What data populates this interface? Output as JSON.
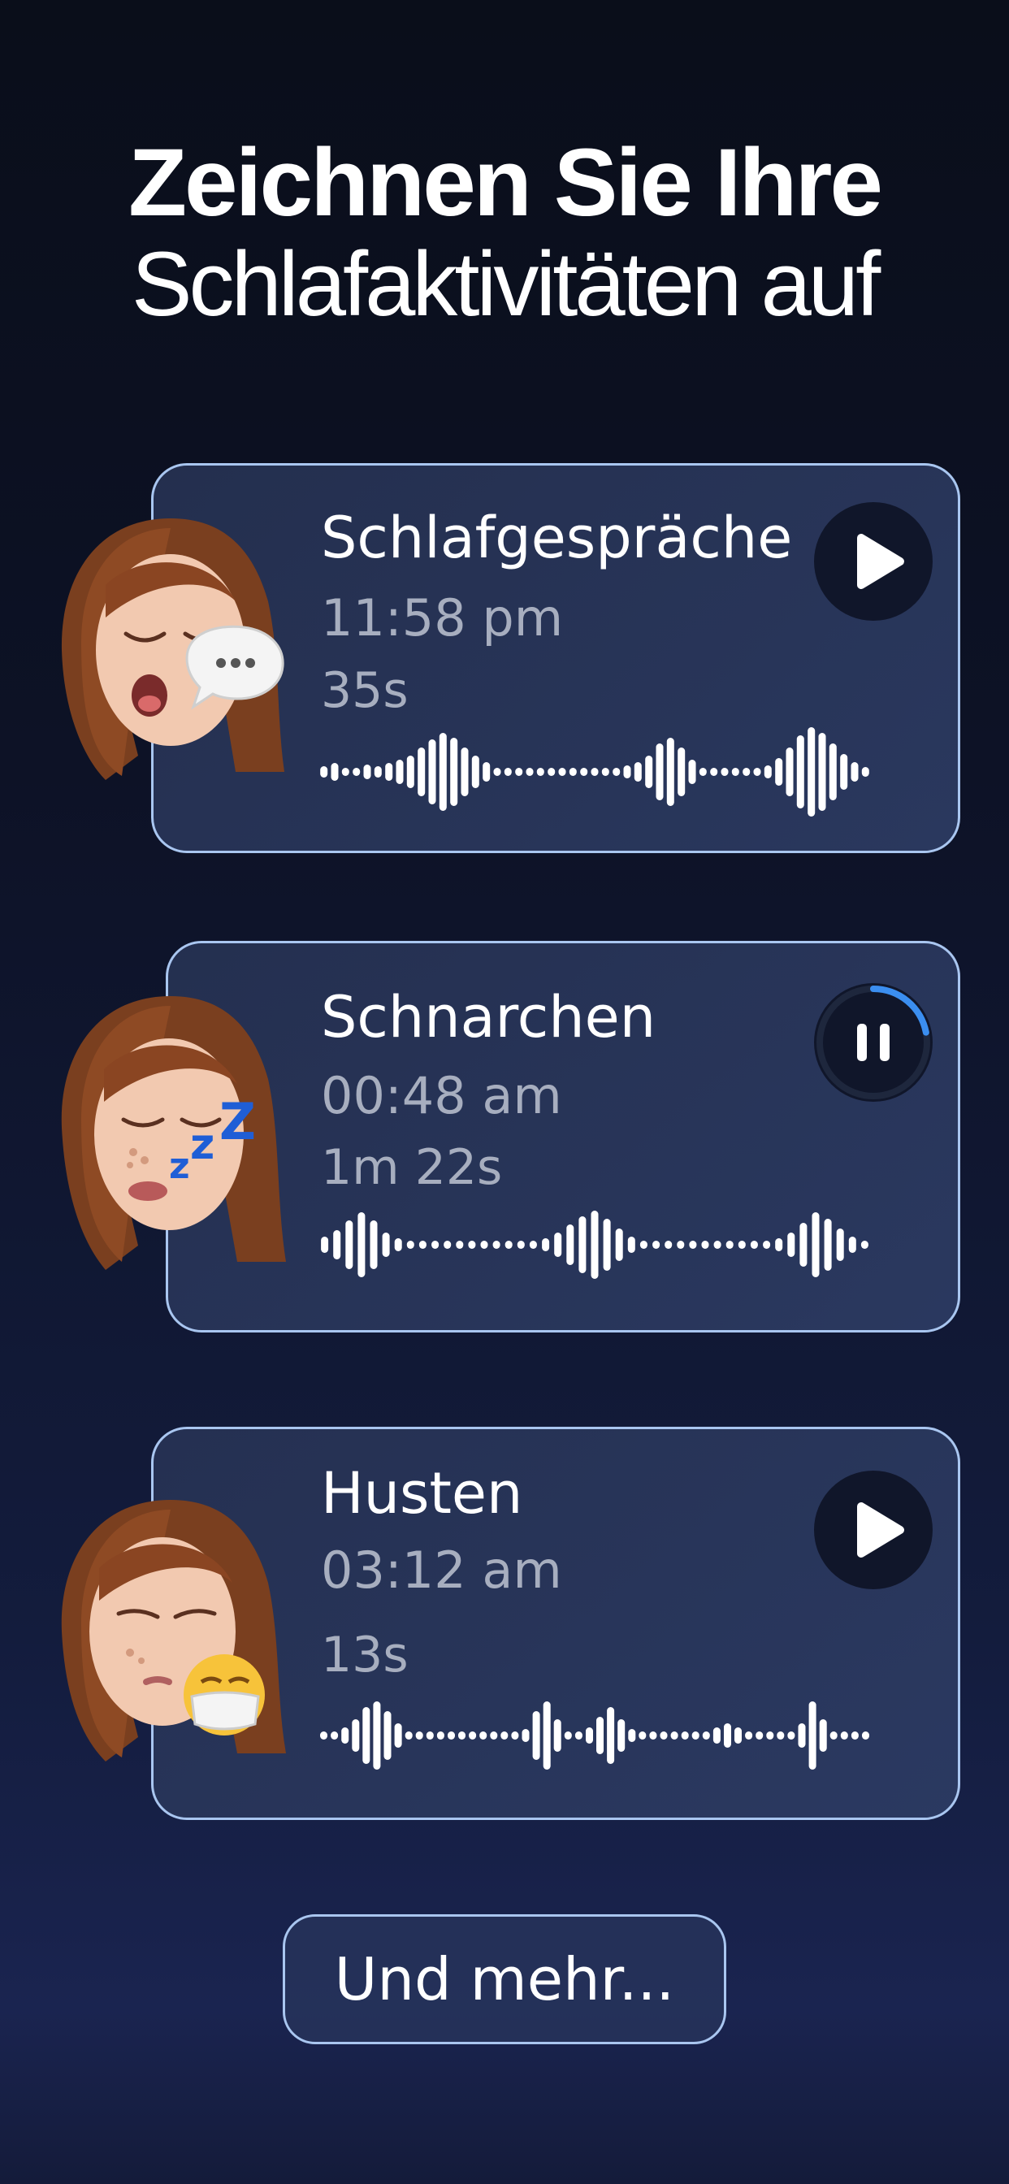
{
  "header": {
    "title_line1": "Zeichnen Sie Ihre",
    "title_line2": "Schlafaktivitäten auf"
  },
  "cards": [
    {
      "title": "Schlafgespräche",
      "time": "11:58 pm",
      "duration": "35s",
      "button_state": "play",
      "avatar_icon": "sleeping-talking-memoji-icon"
    },
    {
      "title": "Schnarchen",
      "time": "00:48 am",
      "duration": "1m 22s",
      "button_state": "pause",
      "progress": 0.22,
      "avatar_icon": "snoring-memoji-icon"
    },
    {
      "title": "Husten",
      "time": "03:12 am",
      "duration": "13s",
      "button_state": "play",
      "avatar_icon": "coughing-memoji-icon"
    }
  ],
  "more_button": {
    "label": "Und mehr..."
  },
  "colors": {
    "card_border": "#a9c6f0",
    "button_bg": "#10162a",
    "progress_accent": "#3b8ef0",
    "secondary_text": "#a7aebf"
  }
}
